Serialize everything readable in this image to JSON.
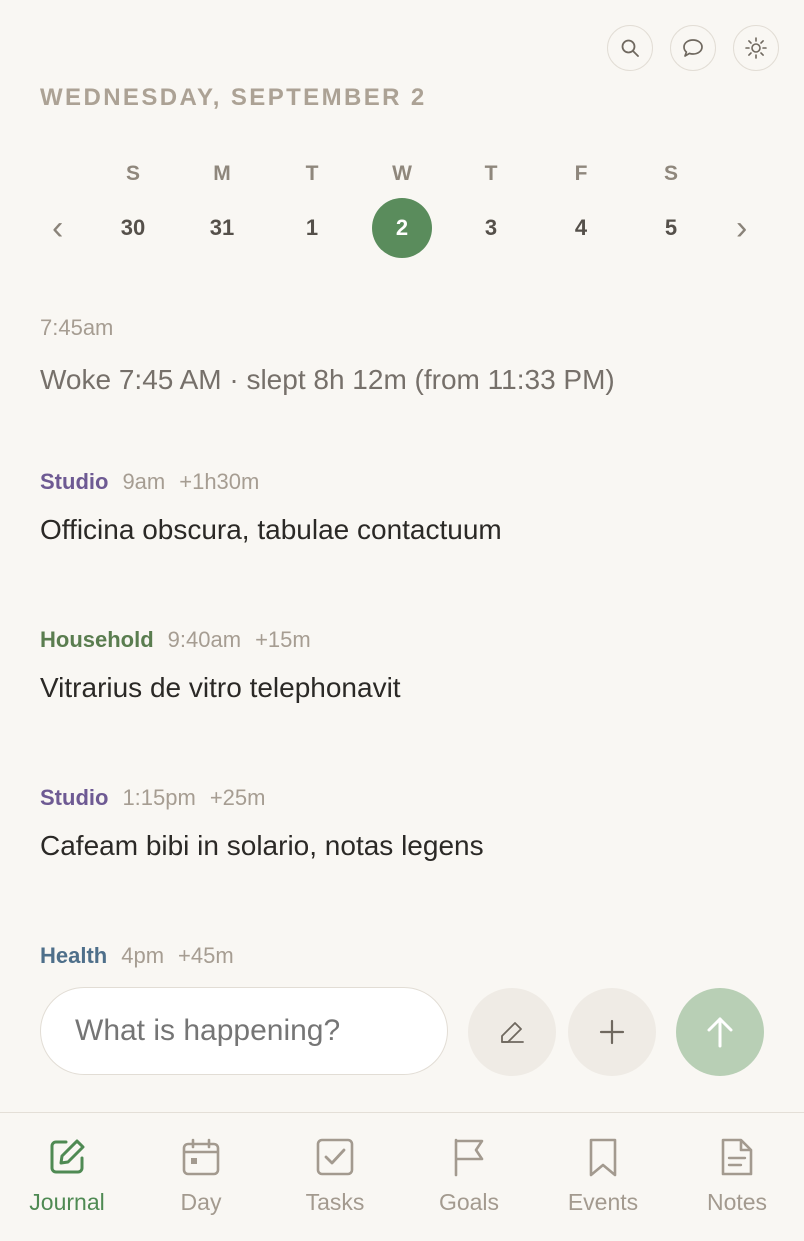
{
  "header": {
    "date_heading": "WEDNESDAY, SEPTEMBER 2",
    "icons": [
      "search-icon",
      "chat-icon",
      "sun-icon"
    ]
  },
  "week": {
    "prev": "‹",
    "next": "›",
    "days": [
      {
        "dow": "S",
        "date": "30"
      },
      {
        "dow": "M",
        "date": "31"
      },
      {
        "dow": "T",
        "date": "1"
      },
      {
        "dow": "W",
        "date": "2"
      },
      {
        "dow": "T",
        "date": "3"
      },
      {
        "dow": "F",
        "date": "4"
      },
      {
        "dow": "S",
        "date": "5"
      }
    ],
    "selected_date": "2"
  },
  "entries": [
    {
      "category": "",
      "category_color": "",
      "time": "7:45am",
      "duration": "",
      "text": "Woke 7:45 AM · slept 8h 12m (from 11:33 PM)"
    },
    {
      "category": "Studio",
      "category_color": "#6e5a93",
      "time": "9am",
      "duration": "+1h30m",
      "text": "Officina obscura, tabulae contactuum"
    },
    {
      "category": "Household",
      "category_color": "#5a7d4f",
      "time": "9:40am",
      "duration": "+15m",
      "text": "Vitrarius de vitro telephonavit"
    },
    {
      "category": "Studio",
      "category_color": "#6e5a93",
      "time": "1:15pm",
      "duration": "+25m",
      "text": "Cafeam bibi in solario, notas legens"
    },
    {
      "category": "Health",
      "category_color": "#4e6f8a",
      "time": "4pm",
      "duration": "+45m",
      "text": ""
    }
  ],
  "composer": {
    "placeholder": "What is happening?",
    "buttons": [
      "pencil-icon",
      "plus-icon",
      "arrow-up-icon"
    ]
  },
  "tabs": [
    {
      "label": "Journal",
      "icon": "journal-icon",
      "active": true
    },
    {
      "label": "Day",
      "icon": "calendar-icon",
      "active": false
    },
    {
      "label": "Tasks",
      "icon": "checkbox-icon",
      "active": false
    },
    {
      "label": "Goals",
      "icon": "flag-icon",
      "active": false
    },
    {
      "label": "Events",
      "icon": "bookmark-icon",
      "active": false
    },
    {
      "label": "Notes",
      "icon": "document-icon",
      "active": false
    }
  ],
  "colors": {
    "accent": "#5a8c5c",
    "background": "#f9f7f3",
    "send_button": "#b8cfb5",
    "muted_text": "#a69d92"
  }
}
